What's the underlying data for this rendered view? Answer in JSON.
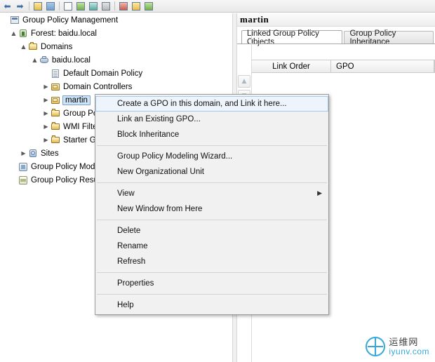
{
  "toolbar": {
    "back_icon": "back-arrow-icon",
    "forward_icon": "forward-arrow-icon",
    "buttons": [
      {
        "name": "folder-up-icon",
        "class": "yellow"
      },
      {
        "name": "show-hide-tree-icon",
        "class": "blue"
      },
      {
        "name": "properties-icon",
        "class": "white"
      },
      {
        "name": "refresh-icon",
        "class": "green"
      },
      {
        "name": "export-list-icon",
        "class": "teal"
      },
      {
        "name": "help-icon",
        "class": "grey"
      },
      {
        "name": "new-window-icon",
        "class": "red"
      },
      {
        "name": "delete-icon",
        "class": "yellow"
      },
      {
        "name": "filter-icon",
        "class": "green"
      }
    ]
  },
  "tree": {
    "nodes": [
      {
        "label": "Group Policy Management",
        "icon": "ic-root",
        "indent": 2,
        "twisty": "",
        "selected": false
      },
      {
        "label": "Forest: baidu.local",
        "icon": "ic-forest",
        "indent": 14,
        "twisty": "▲",
        "selected": false
      },
      {
        "label": "Domains",
        "icon": "ic-domains",
        "indent": 28,
        "twisty": "▲",
        "selected": false
      },
      {
        "label": "baidu.local",
        "icon": "ic-domain",
        "indent": 44,
        "twisty": "▲",
        "selected": false
      },
      {
        "label": "Default Domain Policy",
        "icon": "ic-gpo",
        "indent": 60,
        "twisty": "",
        "selected": false
      },
      {
        "label": "Domain Controllers",
        "icon": "ic-ou",
        "indent": 60,
        "twisty": "▶",
        "selected": false
      },
      {
        "label": "martin",
        "icon": "ic-ou",
        "indent": 60,
        "twisty": "▶",
        "selected": true
      },
      {
        "label": "Group Policy Objects",
        "icon": "ic-folder",
        "indent": 60,
        "twisty": "▶",
        "selected": false
      },
      {
        "label": "WMI Filters",
        "icon": "ic-folder",
        "indent": 60,
        "twisty": "▶",
        "selected": false
      },
      {
        "label": "Starter GPOs",
        "icon": "ic-folder",
        "indent": 60,
        "twisty": "▶",
        "selected": false
      },
      {
        "label": "Sites",
        "icon": "ic-sites",
        "indent": 28,
        "twisty": "▶",
        "selected": false
      },
      {
        "label": "Group Policy Modeling",
        "icon": "ic-modeling",
        "indent": 14,
        "twisty": "",
        "selected": false
      },
      {
        "label": "Group Policy Results",
        "icon": "ic-results",
        "indent": 14,
        "twisty": "",
        "selected": false
      }
    ]
  },
  "right_pane": {
    "title": "martin",
    "tabs": [
      {
        "label": "Linked Group Policy Objects",
        "active": true
      },
      {
        "label": "Group Policy Inheritance",
        "active": false
      }
    ],
    "columns": [
      "Link Order",
      "GPO"
    ],
    "order_buttons": [
      {
        "name": "move-link-up-button",
        "glyph": "▲"
      },
      {
        "name": "move-link-down-button",
        "glyph": "▼"
      },
      {
        "name": "move-link-bottom-button",
        "glyph": "▼"
      }
    ]
  },
  "context_menu": {
    "items": [
      {
        "label": "Create a GPO in this domain, and Link it here...",
        "highlight": true,
        "submenu": false,
        "sep_after": false
      },
      {
        "label": "Link an Existing GPO...",
        "highlight": false,
        "submenu": false,
        "sep_after": false
      },
      {
        "label": "Block Inheritance",
        "highlight": false,
        "submenu": false,
        "sep_after": true
      },
      {
        "label": "Group Policy Modeling Wizard...",
        "highlight": false,
        "submenu": false,
        "sep_after": false
      },
      {
        "label": "New Organizational Unit",
        "highlight": false,
        "submenu": false,
        "sep_after": true
      },
      {
        "label": "View",
        "highlight": false,
        "submenu": true,
        "sep_after": false
      },
      {
        "label": "New Window from Here",
        "highlight": false,
        "submenu": false,
        "sep_after": true
      },
      {
        "label": "Delete",
        "highlight": false,
        "submenu": false,
        "sep_after": false
      },
      {
        "label": "Rename",
        "highlight": false,
        "submenu": false,
        "sep_after": false
      },
      {
        "label": "Refresh",
        "highlight": false,
        "submenu": false,
        "sep_after": true
      },
      {
        "label": "Properties",
        "highlight": false,
        "submenu": false,
        "sep_after": true
      },
      {
        "label": "Help",
        "highlight": false,
        "submenu": false,
        "sep_after": false
      }
    ]
  },
  "watermark": {
    "line1": "运维网",
    "line2": "iyunv.com",
    "accent": "#1f9fd8"
  }
}
